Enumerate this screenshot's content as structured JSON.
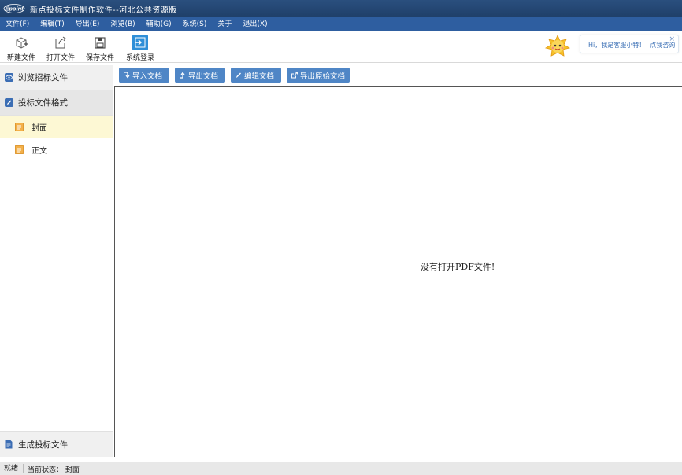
{
  "window": {
    "title": "新点投标文件制作软件--河北公共资源版",
    "logo_text": "Epoint"
  },
  "menu": [
    {
      "label": "文件(F)"
    },
    {
      "label": "编辑(T)"
    },
    {
      "label": "导出(E)"
    },
    {
      "label": "浏览(B)"
    },
    {
      "label": "辅助(G)"
    },
    {
      "label": "系统(S)"
    },
    {
      "label": "关于"
    },
    {
      "label": "退出(X)"
    }
  ],
  "toolbar": {
    "new_label": "新建文件",
    "open_label": "打开文件",
    "save_label": "保存文件",
    "login_label": "系统登录"
  },
  "assistant": {
    "greeting": "Hi，我是客服小特！",
    "link": "点我咨询",
    "close": "×"
  },
  "sidebar": {
    "browse_label": "浏览招标文件",
    "format_label": "投标文件格式",
    "items": [
      {
        "label": "封面"
      },
      {
        "label": "正文"
      }
    ],
    "generate_label": "生成投标文件"
  },
  "actions": {
    "import_label": "导入文档",
    "export_label": "导出文档",
    "edit_label": "编辑文档",
    "export_original_label": "导出原始文档"
  },
  "viewer": {
    "message": "没有打开PDF文件!"
  },
  "status": {
    "ready": "就绪",
    "state": "当前状态： 封面"
  },
  "colors": {
    "titlebar": "#1f3f69",
    "menubar": "#2e5ea0",
    "action_button": "#4f86c6",
    "selected_item": "#fdf8d4"
  }
}
